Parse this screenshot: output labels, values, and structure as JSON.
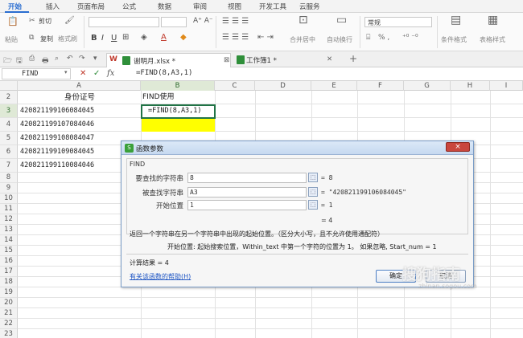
{
  "ribbon_tabs": [
    "开始",
    "插入",
    "页面布局",
    "公式",
    "数据",
    "审阅",
    "视图",
    "开发工具",
    "云服务"
  ],
  "ribbon": {
    "cut": "剪切",
    "paste": "粘贴",
    "copy": "复制",
    "format_painter": "格式刷",
    "merge_center": "合并居中",
    "wrap_text": "自动换行",
    "number_format": "常规",
    "cond_format": "条件格式",
    "table_style": "表格样式",
    "percent_comma": "% ,"
  },
  "doc_tabs": [
    {
      "label": "谢明月.xlsx *",
      "active": true
    },
    {
      "label": "工作簿1 *",
      "active": false
    }
  ],
  "name_box": "FIND",
  "formula_bar_value": "=FIND(8,A3,1)",
  "columns": [
    "A",
    "B",
    "C",
    "D",
    "E",
    "F",
    "G",
    "H",
    "I"
  ],
  "rows": [
    "2",
    "3",
    "4",
    "5",
    "6",
    "7",
    "8",
    "9",
    "10",
    "11",
    "12",
    "13",
    "14",
    "15",
    "16",
    "17",
    "18",
    "19",
    "20",
    "21",
    "22",
    "23",
    "24"
  ],
  "cells": {
    "A2": "身份证号",
    "B2": "FIND使用",
    "A3": "420821199106084045",
    "B3": "=FIND(8,A3,1)",
    "A4": "420821199107084046",
    "A5": "420821199108084047",
    "A6": "420821199109084045",
    "A7": "420821199110084046"
  },
  "dialog": {
    "title": "函数参数",
    "close": "×",
    "function_name": "FIND",
    "args": [
      {
        "label": "要查找的字符串",
        "value": "8",
        "result": "= 8"
      },
      {
        "label": "被查找字符串",
        "value": "A3",
        "result": "= \"420821199106084045\""
      },
      {
        "label": "开始位置",
        "value": "1",
        "result": "= 1"
      }
    ],
    "result_line": "= 4",
    "description": "返回一个字符串在另一个字符串中出现的起始位置。（区分大小写，且不允许使用通配符）",
    "arg_description": "开始位置:  起始搜索位置，Within_text 中第一个字符的位置为 1。 如果忽略, Start_num = 1",
    "calc_result": "计算结果 = 4",
    "help_link": "有关该函数的帮助(H)",
    "ok": "确定",
    "cancel": "取消"
  },
  "watermark": {
    "text": "搜狗指南",
    "sub": "zhinan.sogou.com"
  },
  "colors": {
    "accent": "#2a6dd0",
    "selection_fill": "#ffff00",
    "cell_border": "#217346"
  }
}
